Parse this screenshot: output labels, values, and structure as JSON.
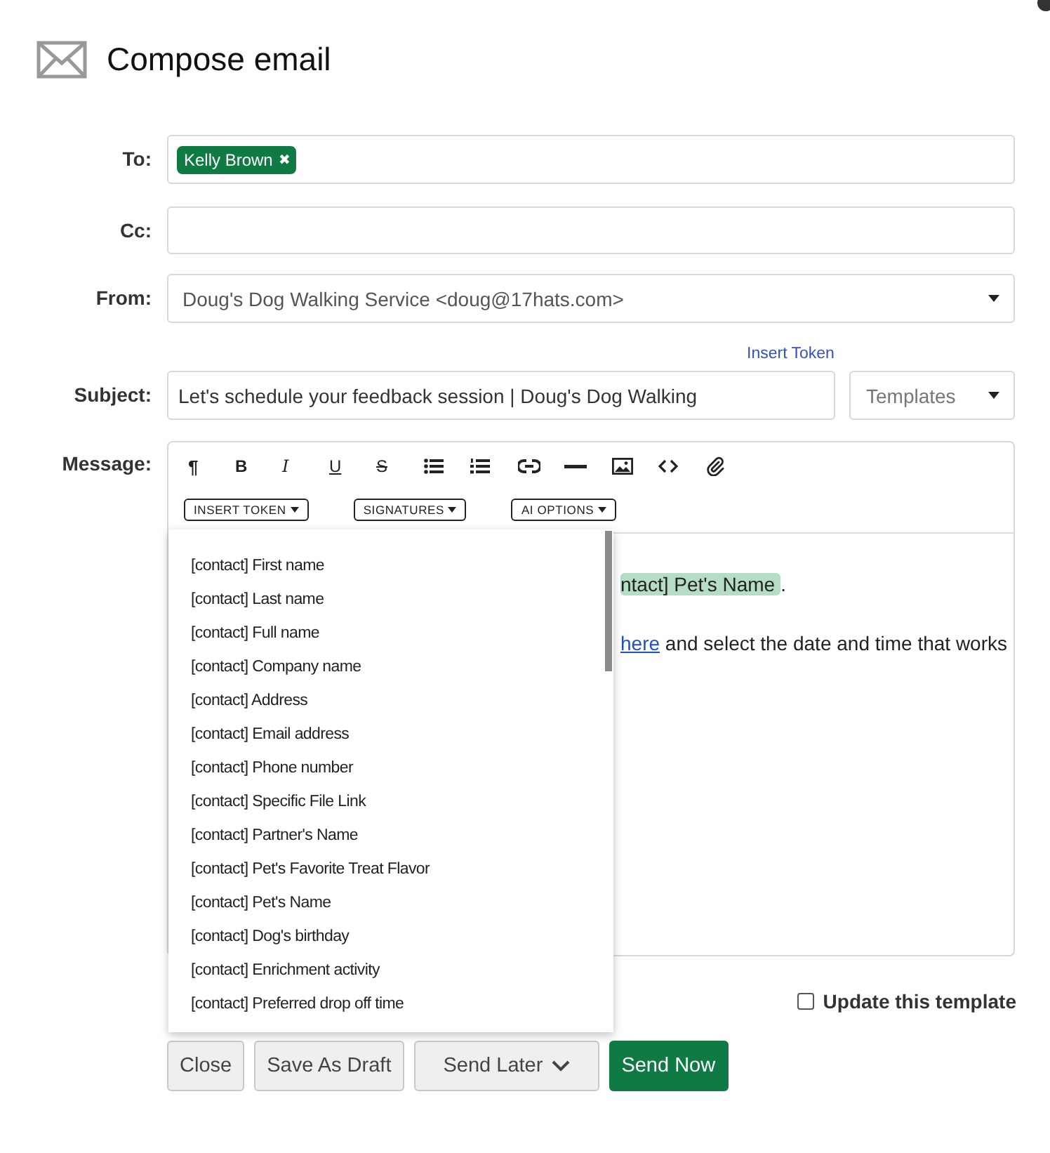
{
  "window": {
    "title": "Compose email"
  },
  "to": {
    "label": "To:",
    "recipients": [
      {
        "name": "Kelly Brown",
        "remove": "✖"
      }
    ]
  },
  "cc": {
    "label": "Cc:"
  },
  "from": {
    "label": "From:",
    "value": "Doug's Dog Walking Service <doug@17hats.com>"
  },
  "insert_token_link": "Insert Token",
  "subject": {
    "label": "Subject:",
    "value": "Let's schedule your feedback session | Doug's Dog Walking",
    "templates": "Templates"
  },
  "message": {
    "label": "Message:",
    "toolbar": [
      {
        "kind": "paragraph",
        "glyph": "¶"
      },
      {
        "kind": "bold",
        "glyph": "B"
      },
      {
        "kind": "italic",
        "glyph": "I"
      },
      {
        "kind": "underline",
        "glyph": "U"
      },
      {
        "kind": "strike",
        "glyph": "S"
      },
      {
        "kind": "bullets"
      },
      {
        "kind": "numbers"
      },
      {
        "kind": "link"
      },
      {
        "kind": "rule"
      },
      {
        "kind": "image"
      },
      {
        "kind": "code"
      },
      {
        "kind": "attach"
      }
    ],
    "menus": [
      "INSERT TOKEN",
      "SIGNATURES",
      "AI OPTIONS"
    ],
    "body": [
      {
        "token": "ntact] Pet's Name",
        "after": "."
      },
      {
        "link": "here",
        "after": " and select the date and time that works"
      }
    ],
    "token_menu": {
      "expanded": true,
      "items": [
        "[contact] First name",
        "[contact] Last name",
        "[contact] Full name",
        "[contact] Company name",
        "[contact] Address",
        "[contact] Email address",
        "[contact] Phone number",
        "[contact] Specific File Link",
        "[contact] Partner's Name",
        "[contact] Pet's Favorite Treat Flavor",
        "[contact] Pet's Name",
        "[contact] Dog's birthday",
        "[contact] Enrichment activity",
        "[contact] Preferred drop off time"
      ]
    }
  },
  "update_template": {
    "label": "Update this template",
    "checked": false
  },
  "buttons": [
    {
      "label": "Close",
      "kind": "plain"
    },
    {
      "label": "Save As Draft",
      "kind": "plain"
    },
    {
      "label": "Send Later",
      "kind": "menu"
    },
    {
      "label": "Send Now",
      "kind": "primary"
    }
  ]
}
